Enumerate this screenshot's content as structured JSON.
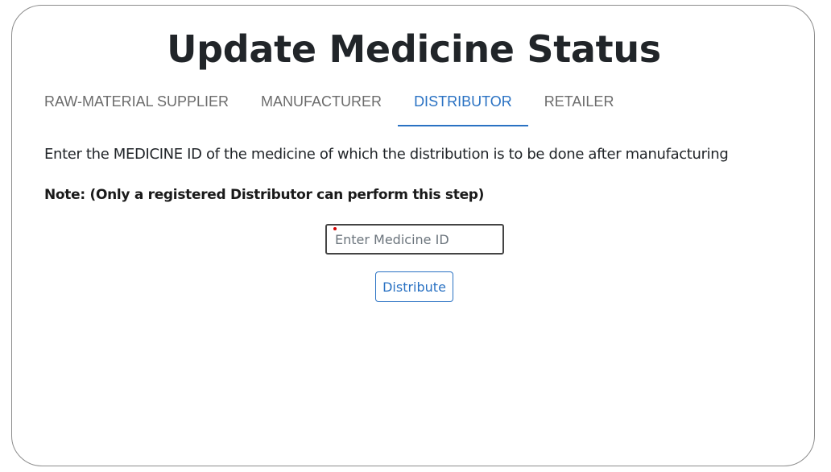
{
  "page": {
    "title": "Update Medicine Status"
  },
  "tabs": [
    {
      "label": "RAW-MATERIAL SUPPLIER",
      "active": false
    },
    {
      "label": "MANUFACTURER",
      "active": false
    },
    {
      "label": "DISTRIBUTOR",
      "active": true
    },
    {
      "label": "RETAILER",
      "active": false
    }
  ],
  "content": {
    "description": "Enter the MEDICINE ID of the medicine of which the distribution is to be done after manufacturing",
    "note": "Note: (Only a registered Distributor can perform this step)",
    "medicine_id_input": {
      "value": "",
      "placeholder": "Enter Medicine ID"
    },
    "submit_label": "Distribute"
  },
  "colors": {
    "accent": "#2a72c3",
    "tab_inactive": "#6c6c6c",
    "text": "#212529"
  }
}
